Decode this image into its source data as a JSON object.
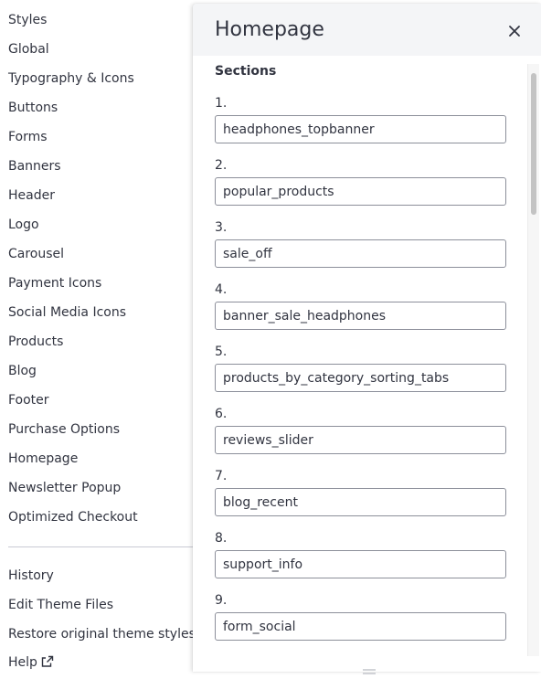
{
  "sidebar": {
    "items": [
      {
        "label": "Styles"
      },
      {
        "label": "Global"
      },
      {
        "label": "Typography & Icons"
      },
      {
        "label": "Buttons"
      },
      {
        "label": "Forms"
      },
      {
        "label": "Banners"
      },
      {
        "label": "Header"
      },
      {
        "label": "Logo"
      },
      {
        "label": "Carousel"
      },
      {
        "label": "Payment Icons"
      },
      {
        "label": "Social Media Icons"
      },
      {
        "label": "Products"
      },
      {
        "label": "Blog"
      },
      {
        "label": "Footer"
      },
      {
        "label": "Purchase Options"
      },
      {
        "label": "Homepage"
      },
      {
        "label": "Newsletter Popup"
      },
      {
        "label": "Optimized Checkout"
      }
    ],
    "footer_items": [
      {
        "label": "History"
      },
      {
        "label": "Edit Theme Files"
      },
      {
        "label": "Restore original theme styles"
      },
      {
        "label": "Help",
        "icon": "external-link-icon"
      }
    ]
  },
  "panel": {
    "title": "Homepage",
    "close_icon": "close-icon",
    "sections_label": "Sections",
    "sections": [
      {
        "number": "1.",
        "value": "headphones_topbanner"
      },
      {
        "number": "2.",
        "value": "popular_products"
      },
      {
        "number": "3.",
        "value": "sale_off"
      },
      {
        "number": "4.",
        "value": "banner_sale_headphones"
      },
      {
        "number": "5.",
        "value": "products_by_category_sorting_tabs"
      },
      {
        "number": "6.",
        "value": "reviews_slider"
      },
      {
        "number": "7.",
        "value": "blog_recent"
      },
      {
        "number": "8.",
        "value": "support_info"
      },
      {
        "number": "9.",
        "value": "form_social"
      }
    ]
  },
  "colors": {
    "text": "#313440",
    "header_bg": "#f4f5f7",
    "input_border": "#8c8f9a",
    "divider": "#c9cbd3"
  }
}
